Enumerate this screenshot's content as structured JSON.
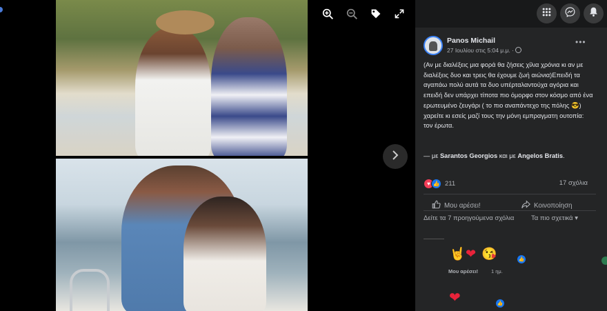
{
  "viewer": {
    "toolbar": {
      "zoom_in": "zoom-in-icon",
      "zoom_out": "zoom-out-icon",
      "tag": "tag-icon",
      "fullscreen": "fullscreen-icon"
    },
    "next_icon": "chevron-right-icon"
  },
  "topbar": {
    "menu_icon": "grid-menu-icon",
    "messenger_icon": "messenger-icon",
    "notifications_icon": "bell-icon"
  },
  "post": {
    "author": "Panos Michail",
    "timestamp": "27 Ιουλίου στις 5:04 μ.μ. · ",
    "more_label": "•••",
    "text": "(Αν με διαλέξεις μια φορά θα ζήσεις χίλια χρόνια κι αν με διαλέξεις δυο και τρεις θα έχουμε ζωή αιώνια)Επειδή τα αγαπάω πολύ αυτά τα δυο υπέρταλαντούχα αγόρια και επειδή δεν υπάρχει τίποτα πιο όμορφο στον κόσμο από ένα ερωτευμένο ζευγάρι ( το πιο αναπάντεχο της πόλης 😎) χαρείτε κι εσείς μαζί τους την μόνη εμπραγματη ουτοπία: τον έρωτα.",
    "with_prefix": "— με ",
    "tag1": "Sarantos Georgios",
    "with_conj": " και με ",
    "tag2": "Angelos Bratis",
    "tag_end": "."
  },
  "stats": {
    "reaction_count": "211",
    "comment_count": "17 σχόλια"
  },
  "actions": {
    "like_label": "Μου αρέσει!",
    "share_label": "Κοινοποίηση"
  },
  "comments": {
    "previous_label": "Δείτε τα 7 προηγούμενα σχόλια",
    "sort_label": "Τα πιο σχετικά ▾",
    "like_link": "Μου αρέσει!",
    "time": "1 ημ."
  },
  "colors": {
    "panel_bg": "#242526",
    "accent": "#1877f2",
    "love": "#f33e58"
  }
}
